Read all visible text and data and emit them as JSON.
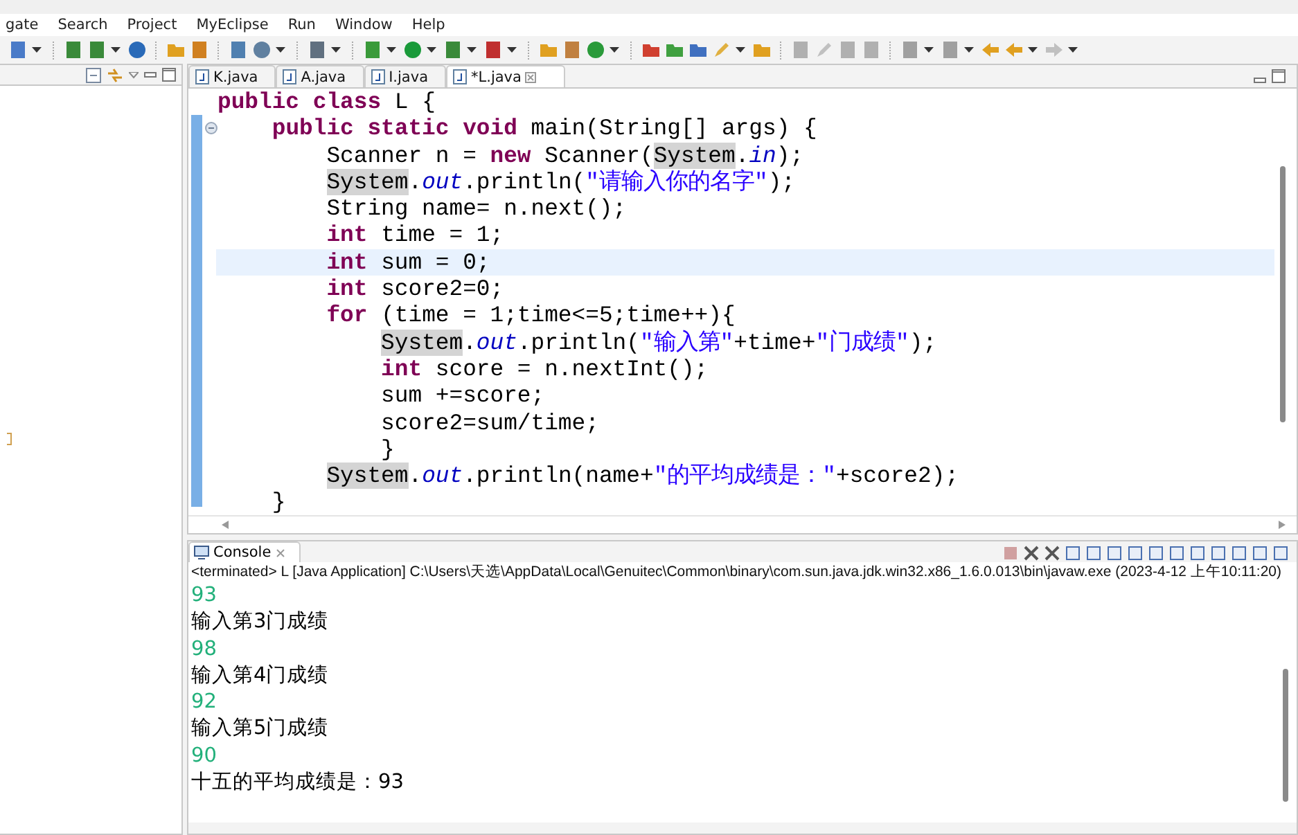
{
  "menu": [
    {
      "label": "gate"
    },
    {
      "label": "Search"
    },
    {
      "label": "Project"
    },
    {
      "label": "MyEclipse"
    },
    {
      "label": "Run"
    },
    {
      "label": "Window"
    },
    {
      "label": "Help"
    }
  ],
  "editor_tabs": [
    {
      "label": "K.java",
      "selected": false
    },
    {
      "label": "A.java",
      "selected": false
    },
    {
      "label": "I.java",
      "selected": false
    },
    {
      "label": "*L.java",
      "selected": true
    }
  ],
  "code_lines": [
    {
      "current": false,
      "tokens": [
        {
          "kind": "kw",
          "text": "public class"
        },
        {
          "kind": "text",
          "text": " L {"
        }
      ]
    },
    {
      "current": false,
      "tokens": [
        {
          "kind": "kw",
          "text": "    public static void"
        },
        {
          "kind": "text",
          "text": " main(String[] args) {"
        }
      ]
    },
    {
      "current": false,
      "tokens": [
        {
          "kind": "text",
          "text": "        Scanner n = "
        },
        {
          "kind": "kw",
          "text": "new"
        },
        {
          "kind": "text",
          "text": " Scanner("
        },
        {
          "kind": "mark",
          "text": "System"
        },
        {
          "kind": "text",
          "text": "."
        },
        {
          "kind": "field",
          "text": "in"
        },
        {
          "kind": "text",
          "text": ");"
        }
      ]
    },
    {
      "current": false,
      "tokens": [
        {
          "kind": "mark",
          "text": "        System"
        },
        {
          "kind": "text",
          "text": "."
        },
        {
          "kind": "field",
          "text": "out"
        },
        {
          "kind": "text",
          "text": ".println("
        },
        {
          "kind": "str",
          "text": "\"请输入你的名字\""
        },
        {
          "kind": "text",
          "text": ");"
        }
      ]
    },
    {
      "current": false,
      "tokens": [
        {
          "kind": "text",
          "text": "        String name= n.next();"
        }
      ]
    },
    {
      "current": false,
      "tokens": [
        {
          "kind": "kw",
          "text": "        int"
        },
        {
          "kind": "text",
          "text": " time = 1;"
        }
      ]
    },
    {
      "current": true,
      "tokens": [
        {
          "kind": "kw",
          "text": "        int"
        },
        {
          "kind": "text",
          "text": " sum = 0;"
        }
      ]
    },
    {
      "current": false,
      "tokens": [
        {
          "kind": "kw",
          "text": "        int"
        },
        {
          "kind": "text",
          "text": " score2=0;"
        }
      ]
    },
    {
      "current": false,
      "tokens": [
        {
          "kind": "kw",
          "text": "        for"
        },
        {
          "kind": "text",
          "text": " (time = 1;time<=5;time++){"
        }
      ]
    },
    {
      "current": false,
      "tokens": [
        {
          "kind": "mark",
          "text": "            System"
        },
        {
          "kind": "text",
          "text": "."
        },
        {
          "kind": "field",
          "text": "out"
        },
        {
          "kind": "text",
          "text": ".println("
        },
        {
          "kind": "str",
          "text": "\"输入第\""
        },
        {
          "kind": "text",
          "text": "+time+"
        },
        {
          "kind": "str",
          "text": "\"门成绩\""
        },
        {
          "kind": "text",
          "text": ");"
        }
      ]
    },
    {
      "current": false,
      "tokens": [
        {
          "kind": "kw",
          "text": "            int"
        },
        {
          "kind": "text",
          "text": " score = n.nextInt();"
        }
      ]
    },
    {
      "current": false,
      "tokens": [
        {
          "kind": "text",
          "text": "            sum +=score;"
        }
      ]
    },
    {
      "current": false,
      "tokens": [
        {
          "kind": "text",
          "text": "            score2=sum/time;"
        }
      ]
    },
    {
      "current": false,
      "tokens": [
        {
          "kind": "text",
          "text": "            }"
        }
      ]
    },
    {
      "current": false,
      "tokens": [
        {
          "kind": "mark",
          "text": "        System"
        },
        {
          "kind": "text",
          "text": "."
        },
        {
          "kind": "field",
          "text": "out"
        },
        {
          "kind": "text",
          "text": ".println(name+"
        },
        {
          "kind": "str",
          "text": "\"的平均成绩是：\""
        },
        {
          "kind": "text",
          "text": "+score2);"
        }
      ]
    },
    {
      "current": false,
      "tokens": [
        {
          "kind": "text",
          "text": "    }"
        }
      ]
    }
  ],
  "console": {
    "tab": "Console",
    "header": "<terminated> L [Java Application] C:\\Users\\天选\\AppData\\Local\\Genuitec\\Common\\binary\\com.sun.java.jdk.win32.x86_1.6.0.013\\bin\\javaw.exe (2023-4-12 上午10:11:20)",
    "output": [
      {
        "kind": "input",
        "text": "93"
      },
      {
        "kind": "output",
        "text": "输入第3门成绩"
      },
      {
        "kind": "input",
        "text": "98"
      },
      {
        "kind": "output",
        "text": "输入第4门成绩"
      },
      {
        "kind": "input",
        "text": "92"
      },
      {
        "kind": "output",
        "text": "输入第5门成绩"
      },
      {
        "kind": "input",
        "text": "90"
      },
      {
        "kind": "output",
        "text": "十五的平均成绩是：93"
      }
    ]
  }
}
